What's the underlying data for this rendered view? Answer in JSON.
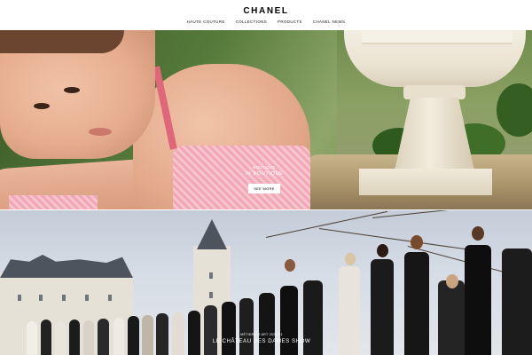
{
  "brand": {
    "logo": "CHANEL"
  },
  "nav": {
    "items": [
      {
        "label": "HAUTE COUTURE"
      },
      {
        "label": "COLLECTIONS"
      },
      {
        "label": "PRODUCTS"
      },
      {
        "label": "CHANEL NEWS"
      }
    ]
  },
  "hero": {
    "kicker": "BOUTIQUE",
    "title": "IN BOUTIQUE",
    "cta_label": "SEE MORE"
  },
  "show": {
    "kicker": "MÉTIERS D'ART 2020/21",
    "title": "LE CHÂTEAU DES DAMES SHOW"
  },
  "colors": {
    "header_bg": "#ffffff",
    "text": "#000000",
    "cta_bg": "#ffffff"
  }
}
